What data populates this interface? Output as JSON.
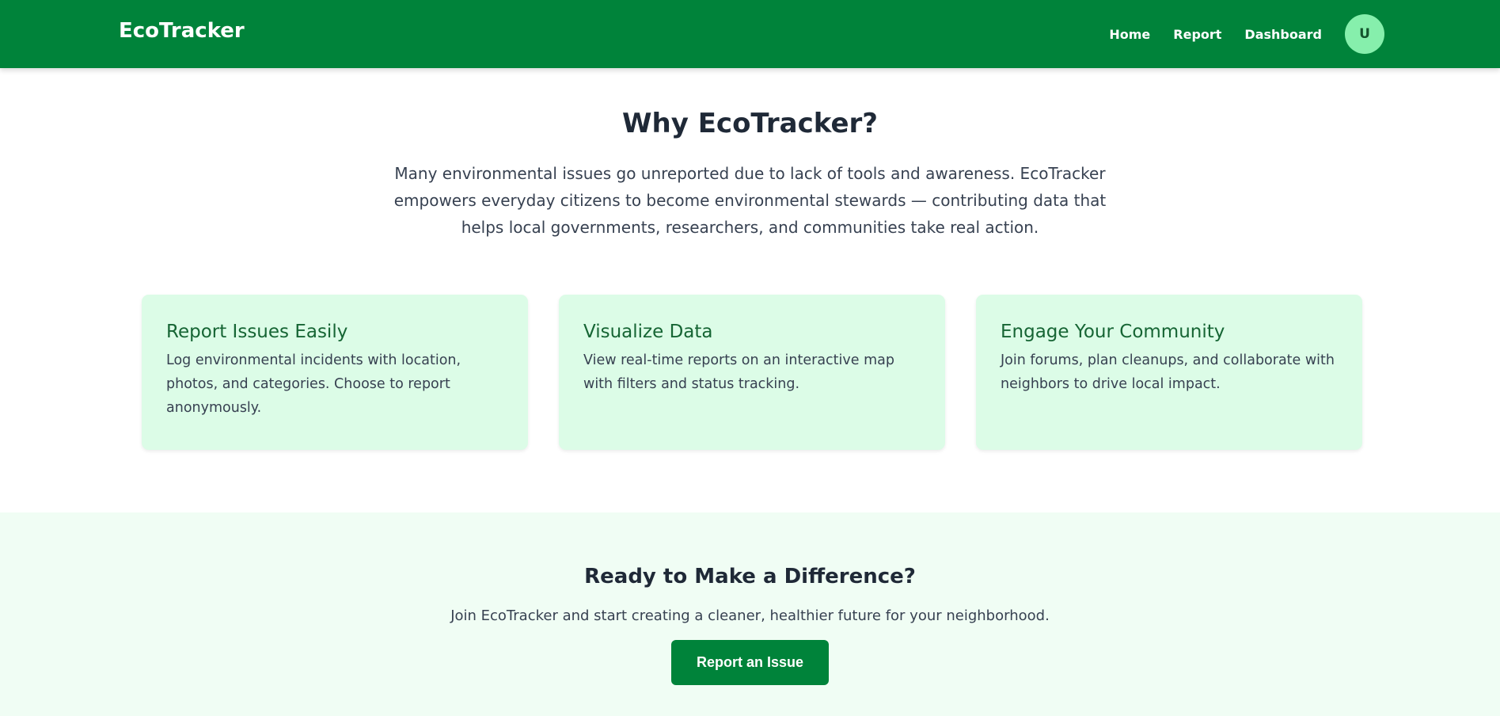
{
  "header": {
    "logo": "EcoTracker",
    "nav": [
      "Home",
      "Report",
      "Dashboard"
    ],
    "avatar": "U"
  },
  "why": {
    "title": "Why EcoTracker?",
    "text": "Many environmental issues go unreported due to lack of tools and awareness. EcoTracker empowers everyday citizens to become environmental stewards — contributing data that helps local governments, researchers, and communities take real action."
  },
  "cards": [
    {
      "title": "Report Issues Easily",
      "text": "Log environmental incidents with location, photos, and categories. Choose to report anonymously."
    },
    {
      "title": "Visualize Data",
      "text": "View real-time reports on an interactive map with filters and status tracking."
    },
    {
      "title": "Engage Your Community",
      "text": "Join forums, plan cleanups, and collaborate with neighbors to drive local impact."
    }
  ],
  "cta": {
    "title": "Ready to Make a Difference?",
    "text": "Join EcoTracker and start creating a cleaner, healthier future for your neighborhood.",
    "button": "Report an Issue"
  },
  "colors": {
    "brand": "#00833a",
    "avatar": "#86efac",
    "card_bg": "#dcfce7",
    "cta_bg": "#f0fdf4"
  }
}
